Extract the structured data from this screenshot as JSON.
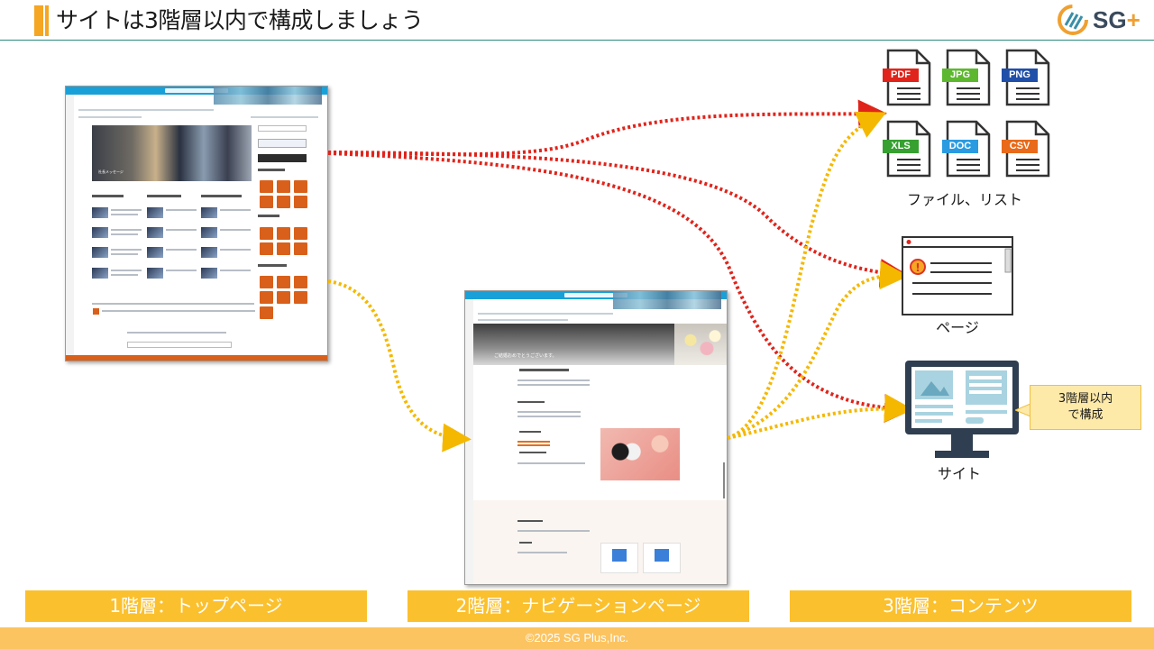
{
  "header": {
    "title": "サイトは3階層以内で構成しましょう",
    "logo_text": "SG",
    "logo_plus": "+"
  },
  "shot1": {
    "hero_caption": "社長メッセージ"
  },
  "shot2": {
    "hero_caption": "ご結婚おめでとうございます。"
  },
  "files": [
    {
      "label": "PDF",
      "color": "#e0241b"
    },
    {
      "label": "JPG",
      "color": "#5db830"
    },
    {
      "label": "PNG",
      "color": "#1f4fa8"
    },
    {
      "label": "XLS",
      "color": "#36a030"
    },
    {
      "label": "DOC",
      "color": "#2a9be0"
    },
    {
      "label": "CSV",
      "color": "#e86a1a"
    }
  ],
  "captions": {
    "files": "ファイル、リスト",
    "page": "ページ",
    "site": "サイト"
  },
  "callout": {
    "line1": "3階層以内",
    "line2": "で構成"
  },
  "levels": {
    "level1": "1階層：トップページ",
    "level2": "2階層：ナビゲーションページ",
    "level3": "3階層：コンテンツ"
  },
  "footer": {
    "copyright": "©2025 SG Plus,Inc."
  },
  "colors": {
    "accent": "#f5a623",
    "red_arrow": "#e0241b",
    "yellow_arrow": "#f5b800",
    "level_bg": "#fbc02d",
    "footer_bg": "#fcc460",
    "rule": "#2a8a7a"
  }
}
